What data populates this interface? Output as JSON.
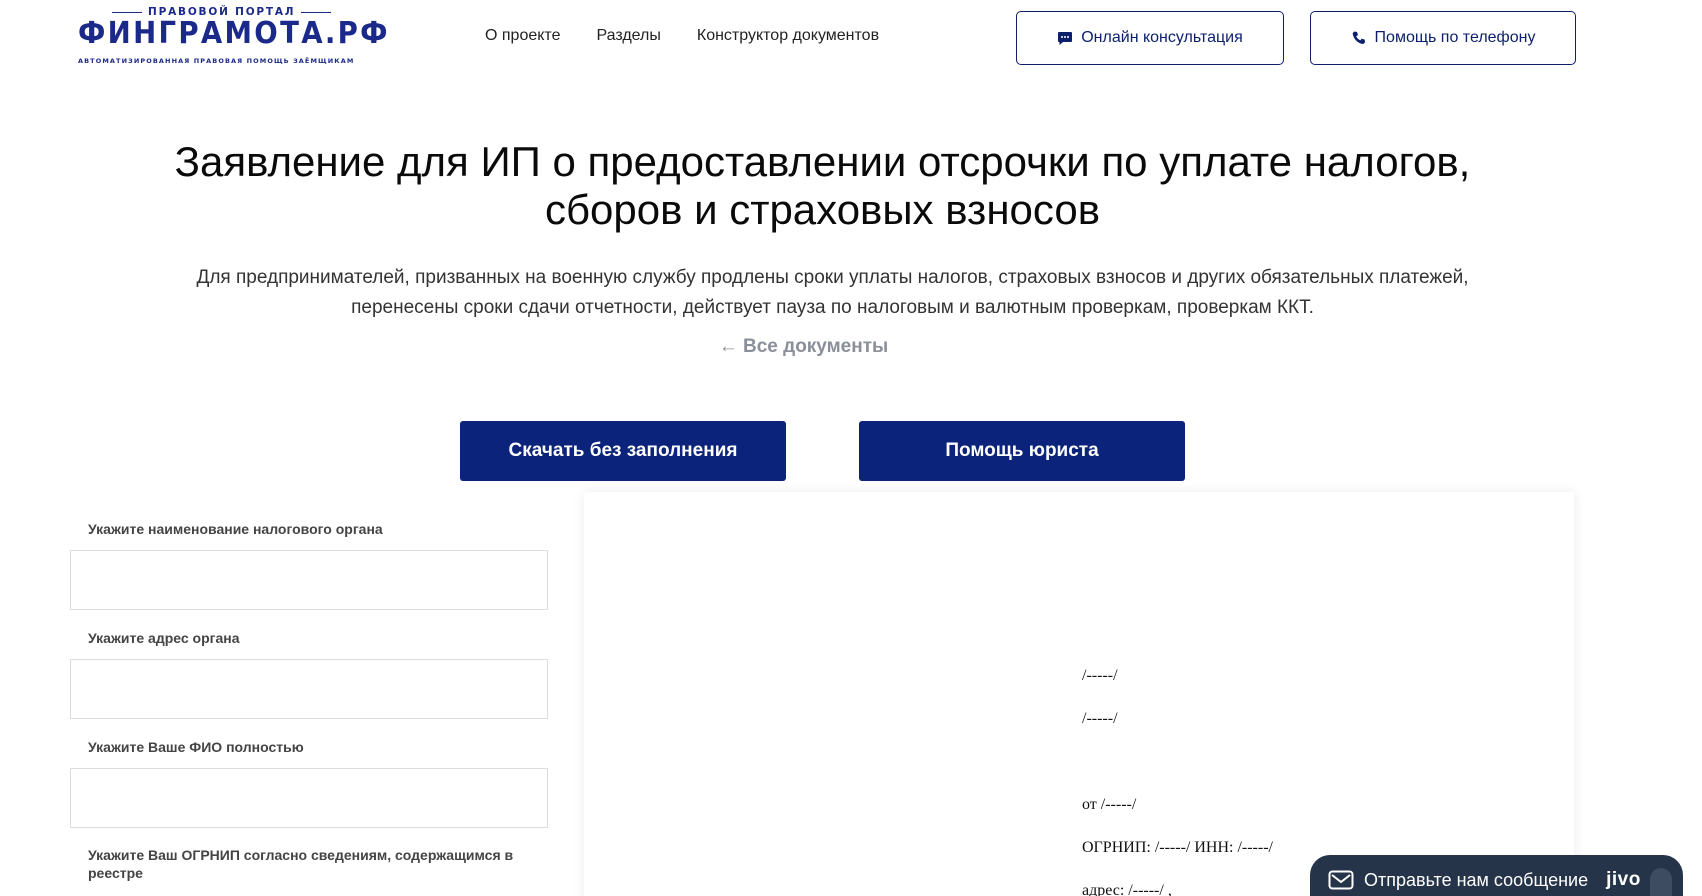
{
  "logo": {
    "top_text": "ПРАВОВОЙ ПОРТАЛ",
    "main_text": "ФИНГРАМОТА.РФ",
    "sub_text": "АВТОМАТИЗИРОВАННАЯ ПРАВОВАЯ ПОМОЩЬ ЗАЁМЩИКАМ"
  },
  "nav": {
    "items": [
      "О проекте",
      "Разделы",
      "Конструктор документов"
    ]
  },
  "header_buttons": {
    "chat_label": "Онлайн консультация",
    "phone_label": "Помощь по телефону"
  },
  "hero": {
    "title_line1": "Заявление для ИП о предоставлении отсрочки по уплате налогов,",
    "title_line2": "сборов и страховых взносов",
    "desc_line1": "Для предпринимателей, призванных на военную службу продлены сроки уплаты налогов, страховых взносов и других обязательных платежей,",
    "desc_line2": "перенесены сроки сдачи отчетности, действует пауза по налоговым и валютным проверкам, проверкам ККТ.",
    "back_link": "← Все документы"
  },
  "actions": {
    "download_label": "Скачать без заполнения",
    "lawyer_label": "Помощь юриста"
  },
  "form": {
    "fields": [
      {
        "label": "Укажите наименование налогового органа",
        "value": ""
      },
      {
        "label": "Укажите адрес органа",
        "value": ""
      },
      {
        "label": "Укажите Ваше ФИО полностью",
        "value": ""
      },
      {
        "label": "Укажите Ваш ОГРНИП согласно сведениям, содержащимся в реестре",
        "value": ""
      }
    ]
  },
  "preview": {
    "lines": [
      "/-----/",
      "/-----/",
      "от /-----/",
      "ОГРНИП: /-----/ ИНН: /-----/",
      "адрес: /-----/ ,"
    ]
  },
  "jivo": {
    "message": "Отправьте нам сообщение",
    "brand": "jivo"
  },
  "colors": {
    "primary": "#0b237a",
    "outline": "#0b1f6b",
    "logo": "#1b2a8a",
    "jivo_bg": "#253448"
  }
}
